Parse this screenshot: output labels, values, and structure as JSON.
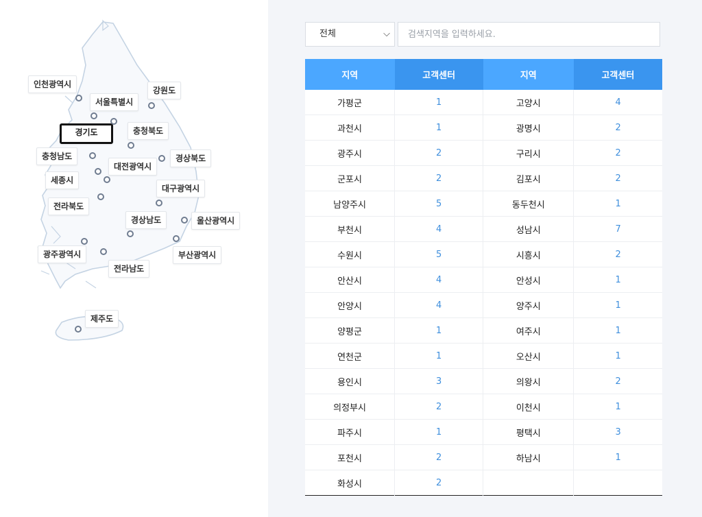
{
  "map": {
    "regions": [
      {
        "name": "인천광역시",
        "active": false
      },
      {
        "name": "서울특별시",
        "active": false
      },
      {
        "name": "강원도",
        "active": false
      },
      {
        "name": "경기도",
        "active": true
      },
      {
        "name": "충청북도",
        "active": false
      },
      {
        "name": "충청남도",
        "active": false
      },
      {
        "name": "대전광역시",
        "active": false
      },
      {
        "name": "경상북도",
        "active": false
      },
      {
        "name": "세종시",
        "active": false
      },
      {
        "name": "대구광역시",
        "active": false
      },
      {
        "name": "전라북도",
        "active": false
      },
      {
        "name": "경상남도",
        "active": false
      },
      {
        "name": "울산광역시",
        "active": false
      },
      {
        "name": "광주광역시",
        "active": false
      },
      {
        "name": "부산광역시",
        "active": false
      },
      {
        "name": "전라남도",
        "active": false
      },
      {
        "name": "제주도",
        "active": false
      }
    ]
  },
  "filter": {
    "select_value": "전체",
    "search_placeholder": "검색지역을 입력하세요."
  },
  "table": {
    "headers": [
      "지역",
      "고객센터",
      "지역",
      "고객센터"
    ],
    "rows": [
      [
        "가평군",
        "1",
        "고양시",
        "4"
      ],
      [
        "과천시",
        "1",
        "광명시",
        "2"
      ],
      [
        "광주시",
        "2",
        "구리시",
        "2"
      ],
      [
        "군포시",
        "2",
        "김포시",
        "2"
      ],
      [
        "남양주시",
        "5",
        "동두천시",
        "1"
      ],
      [
        "부천시",
        "4",
        "성남시",
        "7"
      ],
      [
        "수원시",
        "5",
        "시흥시",
        "2"
      ],
      [
        "안산시",
        "4",
        "안성시",
        "1"
      ],
      [
        "안양시",
        "4",
        "양주시",
        "1"
      ],
      [
        "양평군",
        "1",
        "여주시",
        "1"
      ],
      [
        "연천군",
        "1",
        "오산시",
        "1"
      ],
      [
        "용인시",
        "3",
        "의왕시",
        "2"
      ],
      [
        "의정부시",
        "2",
        "이천시",
        "1"
      ],
      [
        "파주시",
        "1",
        "평택시",
        "3"
      ],
      [
        "포천시",
        "2",
        "하남시",
        "1"
      ],
      [
        "화성시",
        "2",
        "",
        ""
      ]
    ]
  },
  "colors": {
    "header_region": "#4ba7ff",
    "header_count": "#3a95ef",
    "count_text": "#3f8fdd",
    "panel_bg": "#f3f5f9"
  }
}
